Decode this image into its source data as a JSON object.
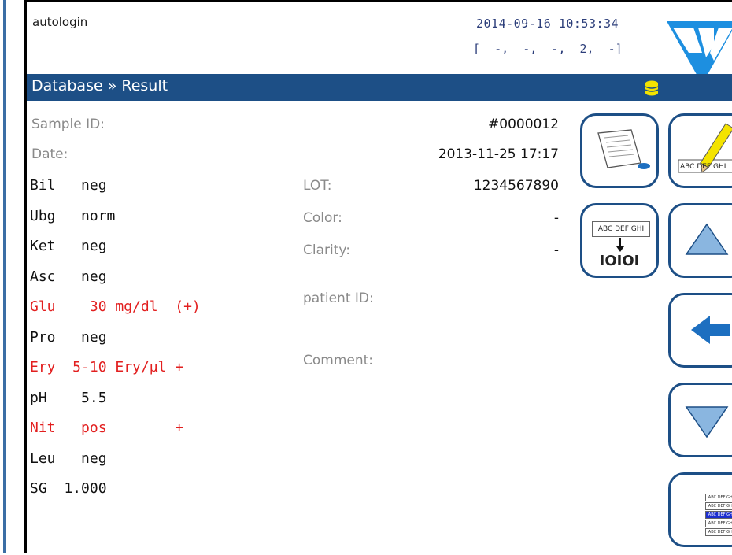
{
  "status": {
    "user": "autologin",
    "datetime": "2014-09-16 10:53:34",
    "codes": "[  -,  -,  -,  2,  -]"
  },
  "titlebar": {
    "breadcrumb": "Database » Result"
  },
  "result": {
    "sample_id_label": "Sample ID:",
    "sample_id": "#0000012",
    "date_label": "Date:",
    "date": "2013-11-25 17:17"
  },
  "parameters": [
    {
      "text": "Bil   neg",
      "abnormal": false
    },
    {
      "text": "Ubg   norm",
      "abnormal": false
    },
    {
      "text": "Ket   neg",
      "abnormal": false
    },
    {
      "text": "Asc   neg",
      "abnormal": false
    },
    {
      "text": "Glu    30 mg/dl  (+)",
      "abnormal": true
    },
    {
      "text": "Pro   neg",
      "abnormal": false
    },
    {
      "text": "Ery  5-10 Ery/µl +",
      "abnormal": true
    },
    {
      "text": "pH    5.5",
      "abnormal": false
    },
    {
      "text": "Nit   pos        +",
      "abnormal": true
    },
    {
      "text": "Leu   neg",
      "abnormal": false
    },
    {
      "text": "SG  1.000",
      "abnormal": false
    }
  ],
  "info": {
    "lot_label": "LOT:",
    "lot": "1234567890",
    "color_label": "Color:",
    "color": "-",
    "clarity_label": "Clarity:",
    "clarity": "-",
    "patient_label": "patient ID:",
    "comment_label": "Comment:"
  },
  "buttons": {
    "edit_text": "ABC DEF GHI",
    "export_top": "ABC DEF GHI",
    "export_bottom": "IOIOI",
    "list_rows": [
      "ABC DEF GHI",
      "ABC DEF GHI",
      "ABC DEF GHI",
      "ABC DEF GHI",
      "ABC DEF GHI"
    ]
  },
  "colors": {
    "accent": "#1d4f86",
    "abnormal": "#e21f1f",
    "label": "#8a8a8a"
  }
}
